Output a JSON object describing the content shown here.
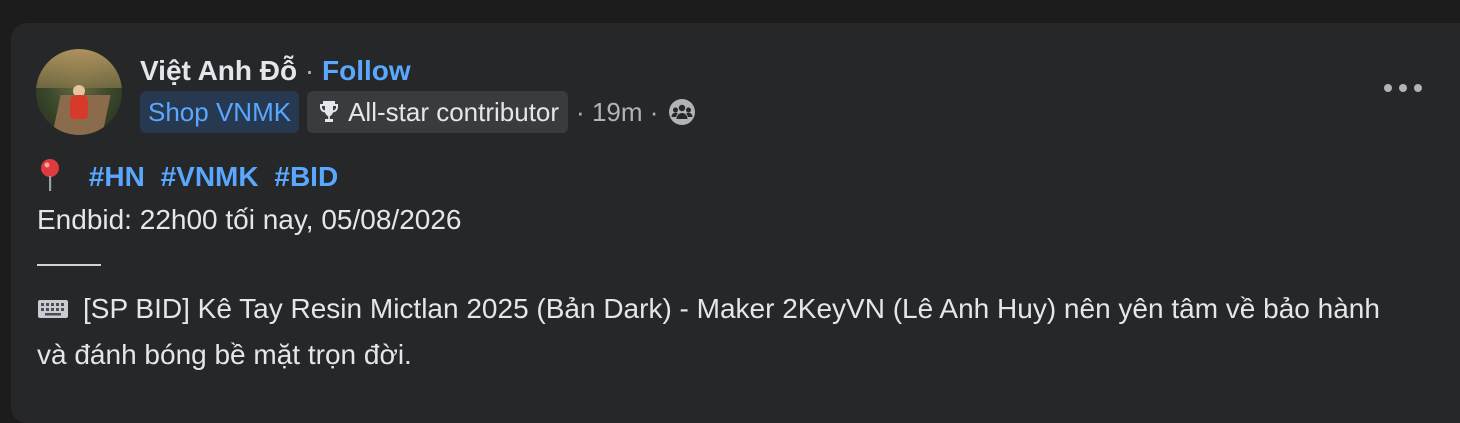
{
  "post": {
    "author_name": "Việt Anh Đỗ",
    "separator": "·",
    "follow_label": "Follow",
    "badges": {
      "group_badge": "Shop VNMK",
      "contributor_badge": "All-star contributor"
    },
    "time_prefix": "·",
    "time": "19m",
    "audience_sep": "·",
    "audience_icon": "group-audience-icon",
    "more_icon": "more-options-icon"
  },
  "content": {
    "pin_icon": "round-pushpin-emoji",
    "hashtags": [
      "#HN",
      "#VNMK",
      "#BID"
    ],
    "endbid": "Endbid: 22h00 tối nay, 05/08/2026",
    "keyboard_icon": "keyboard-emoji",
    "description": "[SP BID] Kê Tay Resin Mictlan 2025 (Bản Dark) - Maker 2KeyVN (Lê Anh Huy) nên yên tâm về bảo hành và đánh bóng bề mặt trọn đời."
  },
  "colors": {
    "background": "#1c1c1d",
    "card": "#252728",
    "link_blue": "#5aa7ff",
    "secondary_text": "#b0b3b8",
    "primary_text": "#e4e6eb"
  }
}
